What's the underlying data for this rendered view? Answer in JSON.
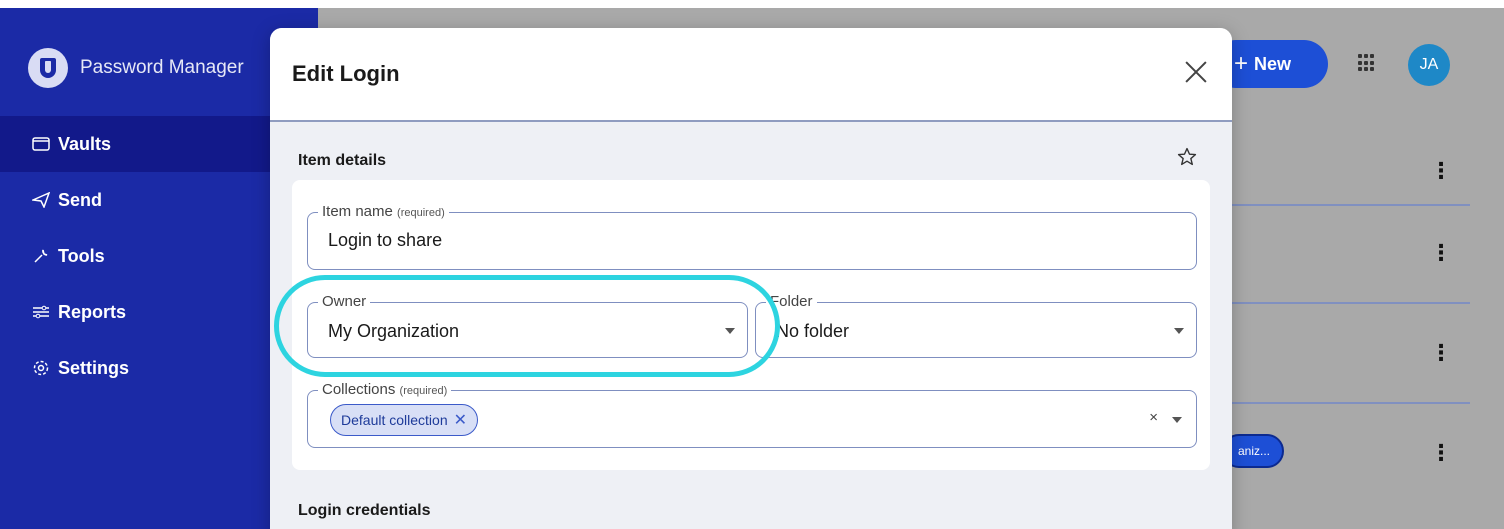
{
  "app": {
    "title": "Password Manager"
  },
  "sidebar": {
    "items": [
      {
        "label": "Vaults",
        "icon": "vault-icon",
        "active": true
      },
      {
        "label": "Send",
        "icon": "send-icon",
        "active": false
      },
      {
        "label": "Tools",
        "icon": "wrench-icon",
        "active": false
      },
      {
        "label": "Reports",
        "icon": "sliders-icon",
        "active": false
      },
      {
        "label": "Settings",
        "icon": "gear-icon",
        "active": false
      }
    ]
  },
  "header": {
    "new_label": "New",
    "avatar_initials": "JA"
  },
  "background_list": {
    "row_chip_label": "aniz..."
  },
  "modal": {
    "title": "Edit Login",
    "item_details_heading": "Item details",
    "login_credentials_heading": "Login credentials",
    "item_name": {
      "label": "Item name",
      "required_note": "(required)",
      "value": "Login to share"
    },
    "owner": {
      "label": "Owner",
      "value": "My Organization"
    },
    "folder": {
      "label": "Folder",
      "value": "No folder"
    },
    "collections": {
      "label": "Collections",
      "required_note": "(required)",
      "chips": [
        "Default collection"
      ],
      "clear_symbol": "×"
    }
  },
  "colors": {
    "sidebar": "#1b2aa6",
    "sidebar_active": "#12198a",
    "primary": "#1d4fd6",
    "highlight": "#2dd4e0",
    "field_border": "#7f8fc0"
  }
}
